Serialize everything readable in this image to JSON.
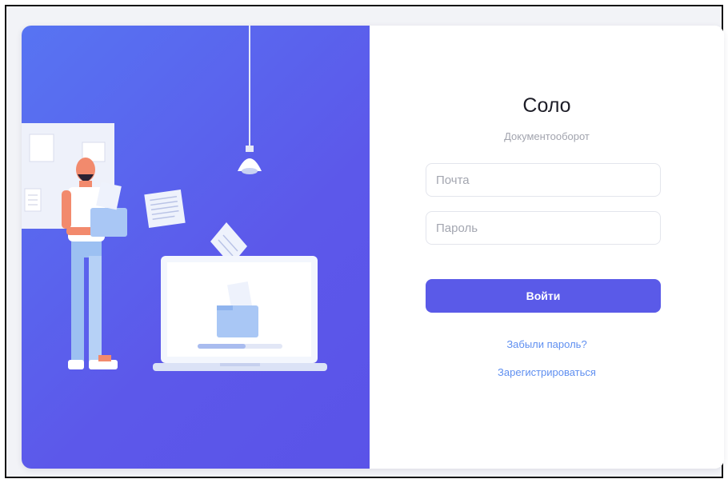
{
  "app": {
    "title": "Соло",
    "subtitle": "Документооборот"
  },
  "form": {
    "email_placeholder": "Почта",
    "password_placeholder": "Пароль",
    "login_label": "Войти",
    "forgot_password_label": "Забыли пароль?",
    "register_label": "Зарегистрироваться"
  },
  "colors": {
    "illustration_bg": "#5a5ae8",
    "primary_button": "#5a5ae8",
    "link": "#5f8ff0"
  },
  "icons": [
    "pendant-lamp-icon",
    "laptop-icon",
    "folder-icon",
    "document-icon",
    "person-illustration"
  ]
}
